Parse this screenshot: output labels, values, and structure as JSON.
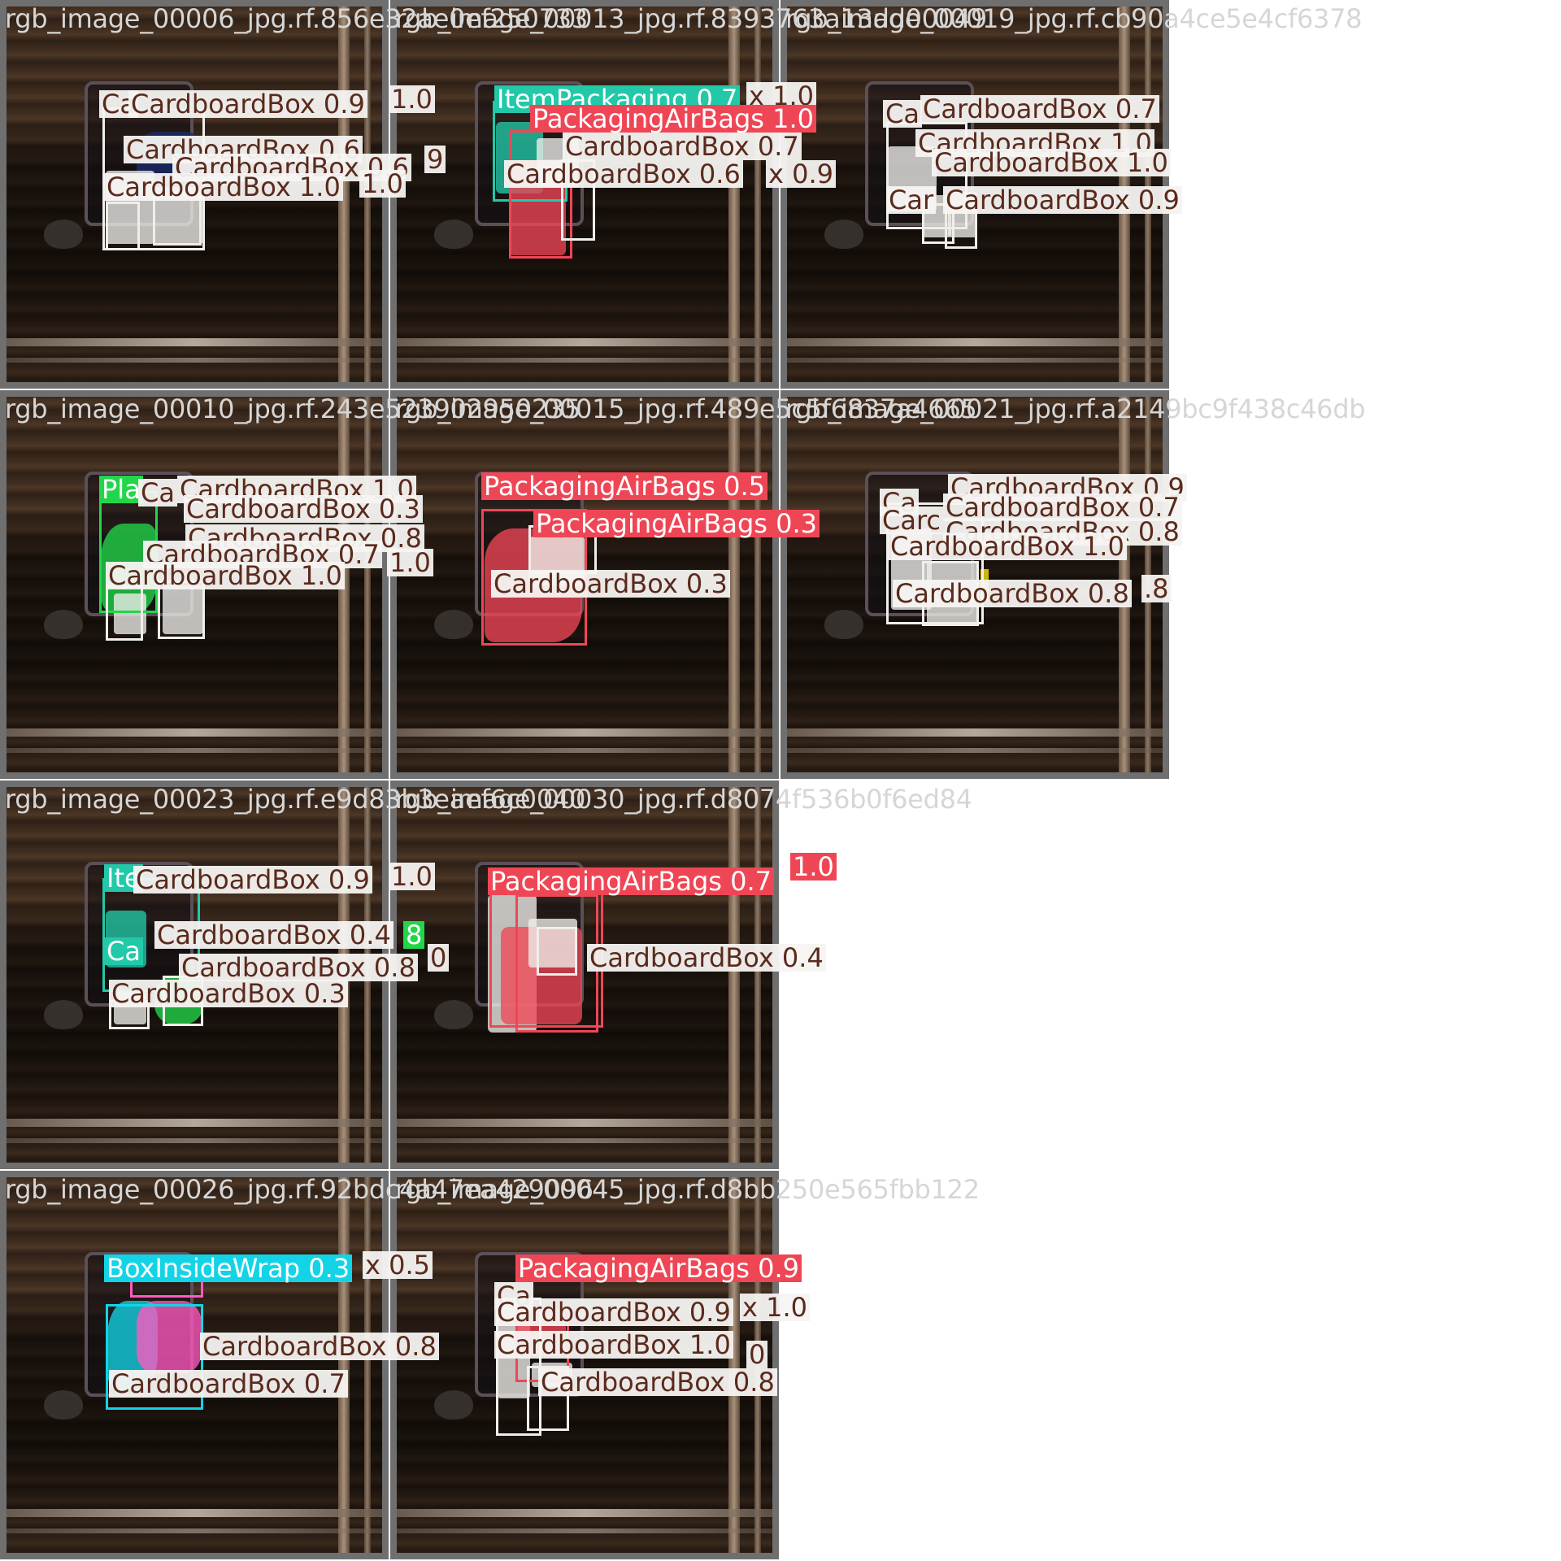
{
  "colors": {
    "CardboardBox": "#f0eeea",
    "ItemPackaging": "#22c9a8",
    "PackagingAirBags": "#ef4656",
    "PlasticWrap": "#22d64a",
    "BoxInsideWrap": "#12d4e6",
    "DarkBox": "#1a2a6a",
    "PinkItem": "#ff59c0",
    "Highlight": "#ffe600"
  },
  "tiles": [
    {
      "filename": "rgb_image_00006_jpg.rf.856e32ae0ef250733",
      "labels": [
        {
          "text": "Ca",
          "style": "light"
        },
        {
          "text": "CardboardBox 0.9",
          "style": "light"
        },
        {
          "text": "1.0",
          "style": "light"
        },
        {
          "text": "CardboardBox 0.6",
          "style": "light"
        },
        {
          "text": "CardboardBox 0.6",
          "style": "light"
        },
        {
          "text": "9",
          "style": "light"
        },
        {
          "text": "CardboardBox 1.0",
          "style": "light"
        },
        {
          "text": "1.0",
          "style": "light"
        }
      ]
    },
    {
      "filename": "rgb_image_00013_jpg.rf.8393763a13dd00049",
      "labels": [
        {
          "text": "ItemPackaging 0.7",
          "style": "teal"
        },
        {
          "text": "x 1.0",
          "style": "light"
        },
        {
          "text": "PackagingAirBags 1.0",
          "style": "red"
        },
        {
          "text": "CardboardBox 0.7",
          "style": "light"
        },
        {
          "text": "CardboardBox 0.6",
          "style": "light"
        },
        {
          "text": "x 0.9",
          "style": "light"
        }
      ]
    },
    {
      "filename": "rgb_image_00019_jpg.rf.cb90a4ce5e4cf6378",
      "labels": [
        {
          "text": "Ca",
          "style": "light"
        },
        {
          "text": "CardboardBox 0.7",
          "style": "light"
        },
        {
          "text": "CardboardBox 1.0",
          "style": "light"
        },
        {
          "text": "CardboardBox 1.0",
          "style": "light"
        },
        {
          "text": "Car",
          "style": "light"
        },
        {
          "text": "CardboardBox 0.9",
          "style": "light"
        }
      ]
    },
    {
      "filename": "rgb_image_00010_jpg.rf.243e523902950235",
      "labels": [
        {
          "text": "Pla",
          "style": "green"
        },
        {
          "text": "Ca",
          "style": "light"
        },
        {
          "text": "CardboardBox 1.0",
          "style": "light"
        },
        {
          "text": "CardboardBox 0.3",
          "style": "light"
        },
        {
          "text": "CardboardBox 0.8",
          "style": "light"
        },
        {
          "text": "CardboardBox 0.7",
          "style": "light"
        },
        {
          "text": "1.0",
          "style": "light"
        },
        {
          "text": "CardboardBox 1.0",
          "style": "light"
        }
      ]
    },
    {
      "filename": "rgb_image_00015_jpg.rf.489e5c5f6837a4665",
      "labels": [
        {
          "text": "PackagingAirBags 0.5",
          "style": "red"
        },
        {
          "text": "PackagingAirBags 0.3",
          "style": "red"
        },
        {
          "text": "CardboardBox 0.3",
          "style": "light"
        }
      ]
    },
    {
      "filename": "rgb_image_00021_jpg.rf.a2149bc9f438c46db",
      "labels": [
        {
          "text": "Ca",
          "style": "light"
        },
        {
          "text": "CardboardBox 0.9",
          "style": "light"
        },
        {
          "text": "Carc",
          "style": "light"
        },
        {
          "text": "CardboardBox 0.7",
          "style": "light"
        },
        {
          "text": "CardboardBox 0.8",
          "style": "light"
        },
        {
          "text": "CardboardBox 1.0",
          "style": "light"
        },
        {
          "text": "CardboardBox 0.8",
          "style": "light"
        },
        {
          "text": ".8",
          "style": "light"
        }
      ]
    },
    {
      "filename": "rgb_image_00023_jpg.rf.e9d83b3eaef6c0040",
      "labels": [
        {
          "text": "Ite",
          "style": "teal"
        },
        {
          "text": "CardboardBox 0.9",
          "style": "light"
        },
        {
          "text": "1.0",
          "style": "light"
        },
        {
          "text": "CardboardBox 0.4",
          "style": "light"
        },
        {
          "text": "8",
          "style": "green"
        },
        {
          "text": "Ca",
          "style": "teal"
        },
        {
          "text": "CardboardBox 0.8",
          "style": "light"
        },
        {
          "text": "0",
          "style": "light"
        },
        {
          "text": "CardboardBox 0.3",
          "style": "light"
        }
      ]
    },
    {
      "filename": "rgb_image_00030_jpg.rf.d8074f536b0f6ed84",
      "labels": [
        {
          "text": "PackagingAirBags 0.7",
          "style": "red"
        },
        {
          "text": "1.0",
          "style": "red"
        },
        {
          "text": "CardboardBox 0.4",
          "style": "light"
        }
      ]
    },
    {
      "filename": "rgb_image_00026_jpg.rf.92bdc4a47ea429096",
      "labels": [
        {
          "text": "BoxInsideWrap 0.3",
          "style": "cyan"
        },
        {
          "text": "x 0.5",
          "style": "light"
        },
        {
          "text": "CardboardBox 0.8",
          "style": "light"
        },
        {
          "text": "CardboardBox 0.7",
          "style": "light"
        }
      ]
    },
    {
      "filename": "rgb_image_00045_jpg.rf.d8bb250e565fbb122",
      "labels": [
        {
          "text": "PackagingAirBags 0.9",
          "style": "red"
        },
        {
          "text": "Ca",
          "style": "light"
        },
        {
          "text": "CardboardBox 0.9",
          "style": "light"
        },
        {
          "text": "x 1.0",
          "style": "light"
        },
        {
          "text": "CardboardBox 1.0",
          "style": "light"
        },
        {
          "text": "0",
          "style": "light"
        },
        {
          "text": "CardboardBox 0.8",
          "style": "light"
        }
      ]
    }
  ]
}
